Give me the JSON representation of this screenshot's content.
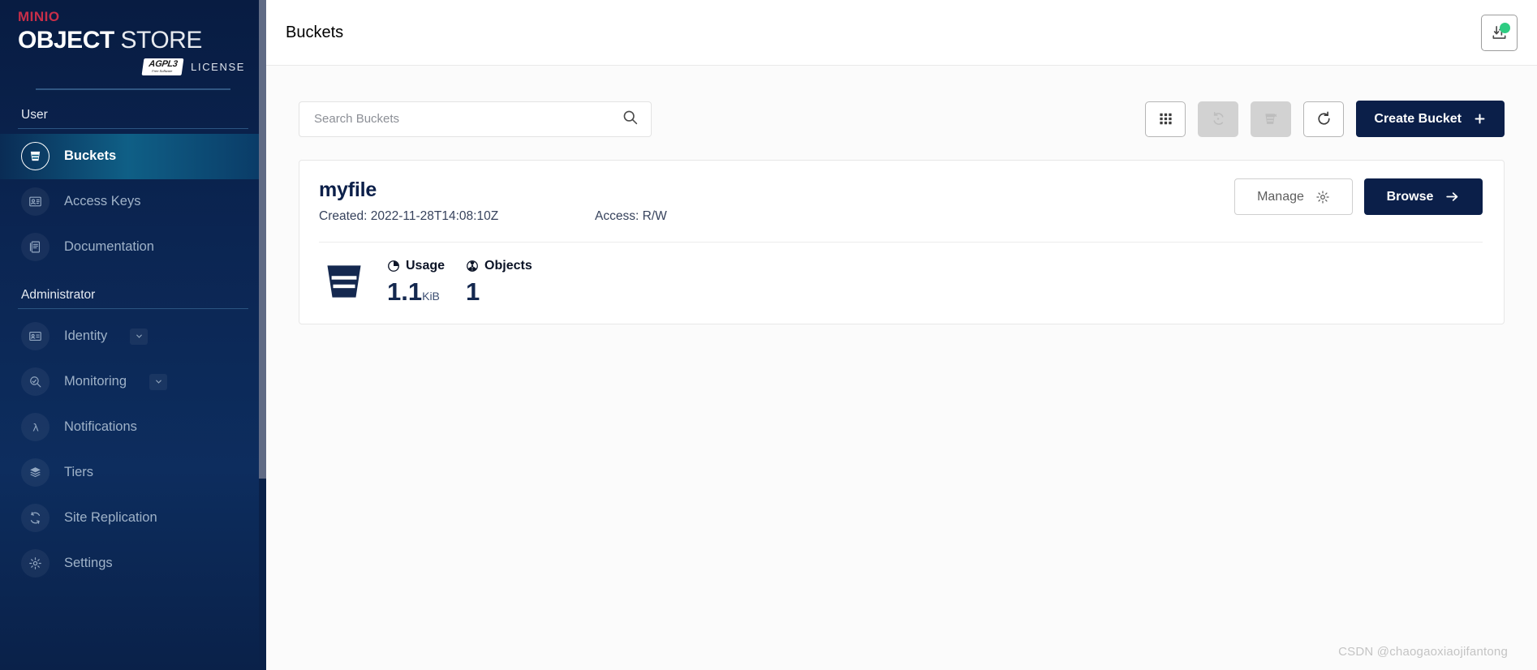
{
  "brand": {
    "min": "MIN",
    "io": "IO",
    "object": "OBJECT",
    "store": "STORE",
    "agpl": "AGPL",
    "agpl_version": "3",
    "agpl_sub": "Free Software",
    "license": "LICENSE",
    "accent_red": "#c72e49",
    "sidebar_bg": "#081c42",
    "active_accent": "#0f5f86"
  },
  "sidebar": {
    "sections": [
      {
        "title": "User",
        "items": [
          {
            "label": "Buckets",
            "icon": "bucket-icon",
            "active": true,
            "expandable": false
          },
          {
            "label": "Access Keys",
            "icon": "access-keys-icon",
            "active": false,
            "expandable": false
          },
          {
            "label": "Documentation",
            "icon": "documentation-icon",
            "active": false,
            "expandable": false
          }
        ]
      },
      {
        "title": "Administrator",
        "items": [
          {
            "label": "Identity",
            "icon": "identity-icon",
            "active": false,
            "expandable": true
          },
          {
            "label": "Monitoring",
            "icon": "monitoring-icon",
            "active": false,
            "expandable": true
          },
          {
            "label": "Notifications",
            "icon": "lambda-icon",
            "active": false,
            "expandable": false
          },
          {
            "label": "Tiers",
            "icon": "tiers-icon",
            "active": false,
            "expandable": false
          },
          {
            "label": "Site Replication",
            "icon": "site-replication-icon",
            "active": false,
            "expandable": false
          },
          {
            "label": "Settings",
            "icon": "settings-gear-icon",
            "active": false,
            "expandable": false
          }
        ]
      }
    ]
  },
  "header": {
    "title": "Buckets",
    "transfer_button_icon": "upload-download-icon",
    "status_dot_color": "#2ecc82"
  },
  "toolbar": {
    "search_placeholder": "Search Buckets",
    "search_value": "",
    "search_icon": "search-icon",
    "buttons": [
      {
        "name": "select-multiple-buckets-button",
        "icon": "grid-icon",
        "disabled": false
      },
      {
        "name": "lifecycle-rules-button",
        "icon": "refresh-cycle-icon",
        "disabled": true
      },
      {
        "name": "delete-selected-buckets-button",
        "icon": "delete-bucket-icon",
        "disabled": true
      },
      {
        "name": "refresh-button",
        "icon": "reload-icon",
        "disabled": false
      }
    ],
    "create_label": "Create Bucket",
    "create_icon": "plus-icon"
  },
  "bucket": {
    "name": "myfile",
    "created_label": "Created: 2022-11-28T14:08:10Z",
    "access_label": "Access: R/W",
    "manage_label": "Manage",
    "manage_icon": "gear-icon",
    "browse_label": "Browse",
    "browse_icon": "arrow-right-icon",
    "glyph": "bucket-icon",
    "usage_label": "Usage",
    "usage_icon": "pie-chart-icon",
    "usage_value": "1.1",
    "usage_unit": "KiB",
    "objects_label": "Objects",
    "objects_icon": "objects-icon",
    "objects_value": "1"
  },
  "watermark": {
    "text": "CSDN @chaogaoxiaojifantong"
  }
}
